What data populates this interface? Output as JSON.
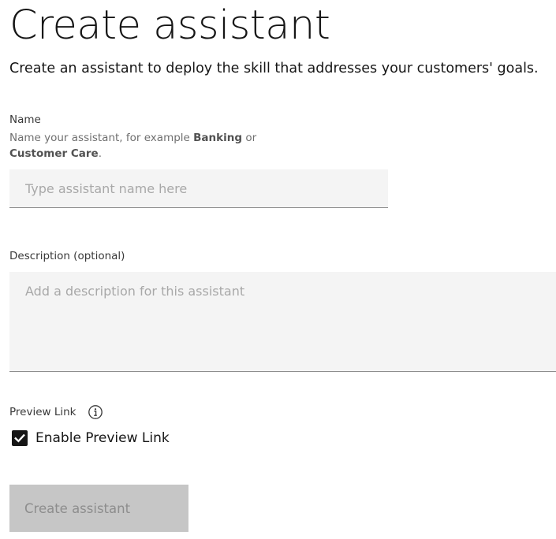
{
  "page": {
    "title": "Create assistant",
    "subtitle": "Create an assistant to deploy the skill that addresses your customers' goals."
  },
  "name_field": {
    "label": "Name",
    "helper_prefix": "Name your assistant, for example ",
    "helper_example_1": "Banking",
    "helper_joiner": " or",
    "helper_example_2": "Customer Care",
    "helper_suffix": ".",
    "placeholder": "Type assistant name here",
    "value": ""
  },
  "description_field": {
    "label": "Description (optional)",
    "placeholder": "Add a description for this assistant",
    "value": ""
  },
  "preview_link": {
    "label": "Preview Link",
    "info_icon": "info-circle-icon",
    "checkbox_label": "Enable Preview Link",
    "checked": true
  },
  "actions": {
    "submit_label": "Create assistant",
    "submit_disabled": true
  },
  "colors": {
    "checkbox_fill": "#161616",
    "input_background": "#f4f4f4",
    "disabled_button_bg": "#c6c6c6",
    "disabled_button_text": "#8d8d8d"
  }
}
